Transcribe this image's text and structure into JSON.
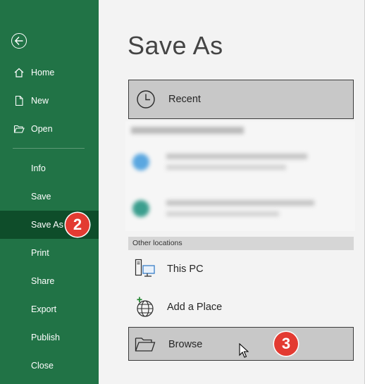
{
  "nav": {
    "items": [
      {
        "label": "Home"
      },
      {
        "label": "New"
      },
      {
        "label": "Open"
      },
      {
        "label": "Info"
      },
      {
        "label": "Save"
      },
      {
        "label": "Save As"
      },
      {
        "label": "Print"
      },
      {
        "label": "Share"
      },
      {
        "label": "Export"
      },
      {
        "label": "Publish"
      },
      {
        "label": "Close"
      }
    ],
    "active": "Save As"
  },
  "page": {
    "title": "Save As"
  },
  "locations": {
    "recent_label": "Recent",
    "other_header": "Other locations",
    "this_pc_label": "This PC",
    "add_place_label": "Add a Place",
    "browse_label": "Browse"
  },
  "callouts": {
    "step2": "2",
    "step3": "3"
  },
  "colors": {
    "nav_bg": "#217346",
    "nav_active": "#0e4d2a",
    "badge": "#e33b32",
    "selected_box": "#c8c8c8"
  }
}
